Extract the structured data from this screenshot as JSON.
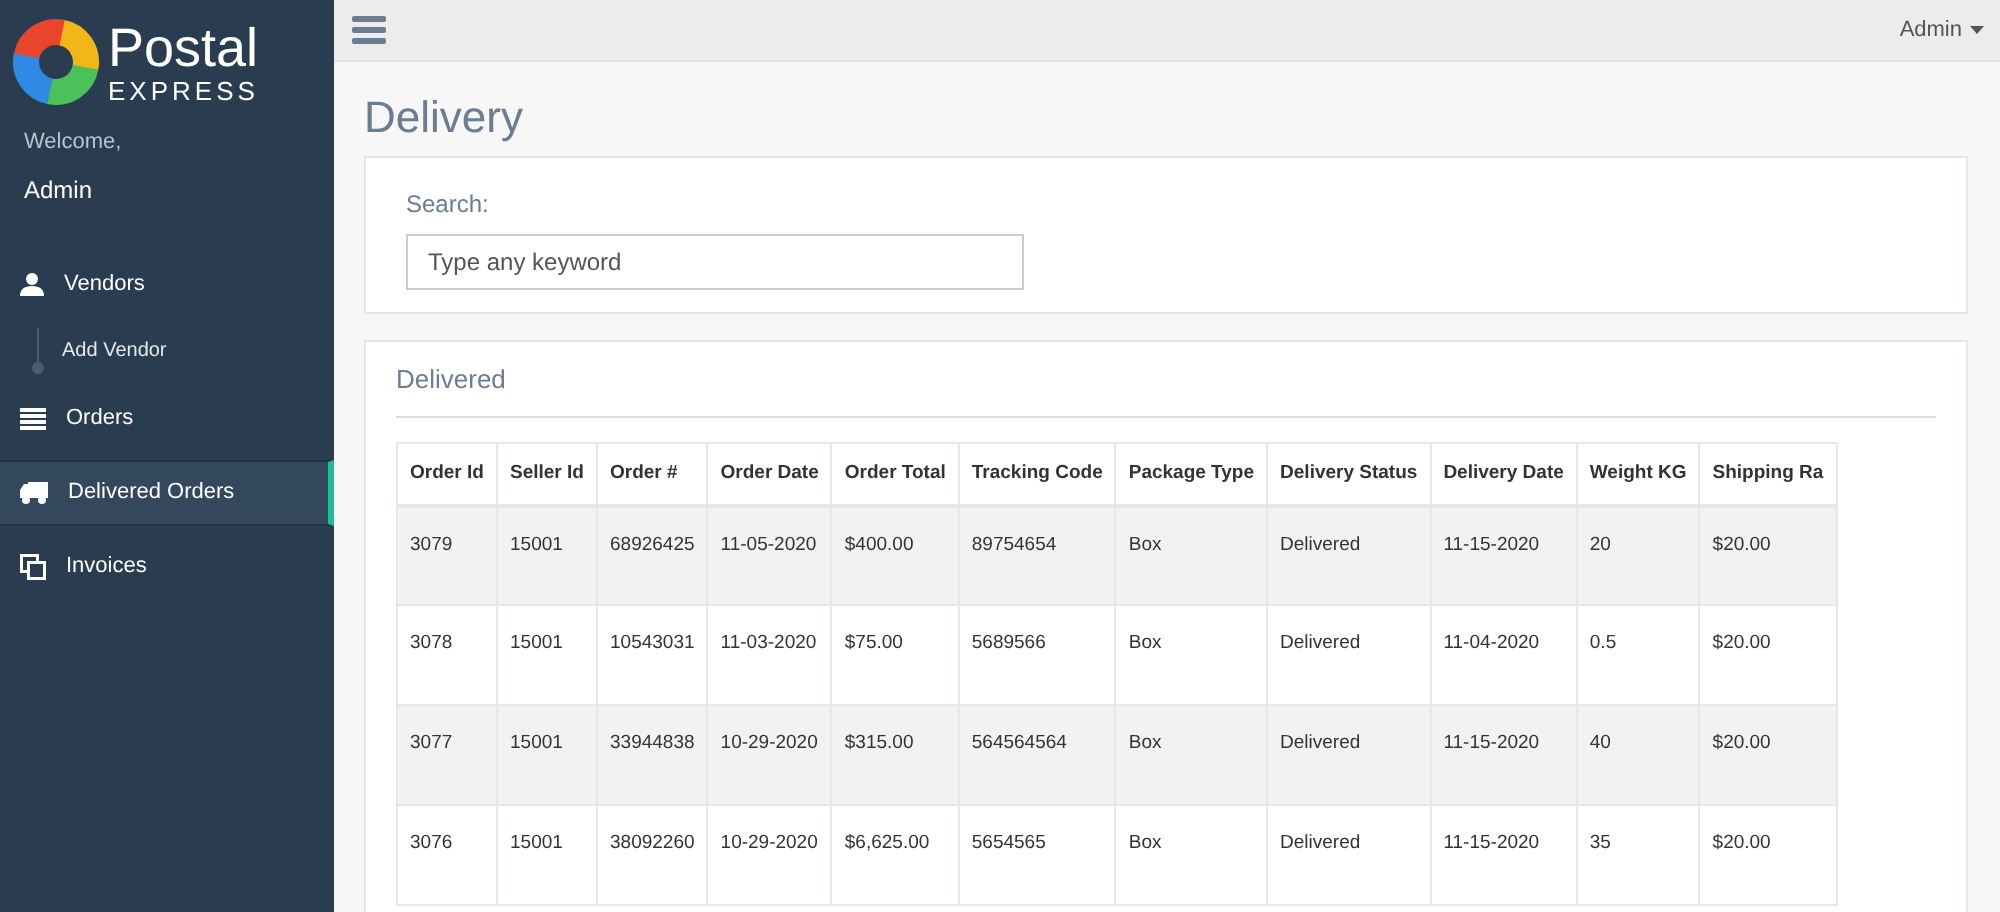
{
  "brand": {
    "name": "Postal",
    "tagline": "EXPRESS"
  },
  "welcome": {
    "greeting": "Welcome,",
    "user": "Admin"
  },
  "sidebar": {
    "items": [
      {
        "label": "Vendors",
        "kind": "user",
        "selected": false,
        "children": [
          {
            "label": "Add Vendor",
            "selected": false
          }
        ]
      },
      {
        "label": "Orders",
        "kind": "list",
        "selected": false
      },
      {
        "label": "Delivered Orders",
        "kind": "truck",
        "selected": true
      },
      {
        "label": "Invoices",
        "kind": "copy",
        "selected": false
      }
    ]
  },
  "topbar": {
    "user_menu": "Admin"
  },
  "page_title": "Delivery",
  "search": {
    "label": "Search:",
    "placeholder": "Type any keyword"
  },
  "table_card": {
    "title": "Delivered"
  },
  "table": {
    "columns": [
      "Order Id",
      "Seller Id",
      "Order #",
      "Order Date",
      "Order Total",
      "Tracking Code",
      "Package Type",
      "Delivery Status",
      "Delivery Date",
      "Weight KG",
      "Shipping Ra"
    ],
    "rows": [
      [
        "3079",
        "15001",
        "68926425",
        "11-05-2020",
        "$400.00",
        "89754654",
        "Box",
        "Delivered",
        "11-15-2020",
        "20",
        "$20.00"
      ],
      [
        "3078",
        "15001",
        "10543031",
        "11-03-2020",
        "$75.00",
        "5689566",
        "Box",
        "Delivered",
        "11-04-2020",
        "0.5",
        "$20.00"
      ],
      [
        "3077",
        "15001",
        "33944838",
        "10-29-2020",
        "$315.00",
        "564564564",
        "Box",
        "Delivered",
        "11-15-2020",
        "40",
        "$20.00"
      ],
      [
        "3076",
        "15001",
        "38092260",
        "10-29-2020",
        "$6,625.00",
        "5654565",
        "Box",
        "Delivered",
        "11-15-2020",
        "35",
        "$20.00"
      ]
    ]
  }
}
